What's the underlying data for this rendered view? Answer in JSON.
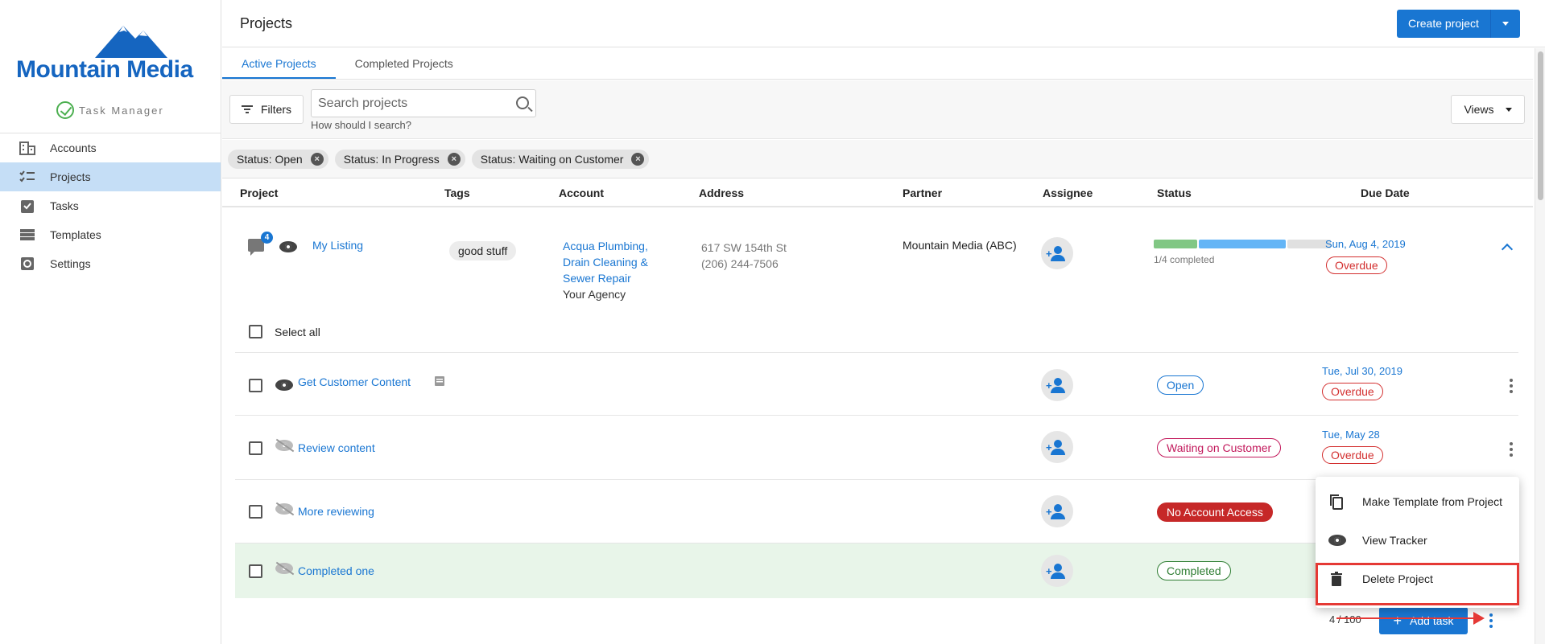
{
  "brand": {
    "logo_text": "Mountain Media",
    "subtitle": "Task Manager",
    "accent": "#1976d2"
  },
  "sidebar": {
    "items": [
      {
        "label": "Accounts",
        "icon": "building-icon",
        "active": false
      },
      {
        "label": "Projects",
        "icon": "checklist-icon",
        "active": true
      },
      {
        "label": "Tasks",
        "icon": "clipboard-check-icon",
        "active": false
      },
      {
        "label": "Templates",
        "icon": "table-icon",
        "active": false
      },
      {
        "label": "Settings",
        "icon": "gear-icon",
        "active": false
      }
    ]
  },
  "header": {
    "title": "Projects",
    "create_label": "Create project"
  },
  "tabs": [
    {
      "label": "Active Projects",
      "active": true
    },
    {
      "label": "Completed Projects",
      "active": false
    }
  ],
  "toolbar": {
    "filters_label": "Filters",
    "search_placeholder": "Search projects",
    "search_value": "",
    "search_help": "How should I search?",
    "views_label": "Views"
  },
  "chips": [
    "Status: Open",
    "Status: In Progress",
    "Status: Waiting on Customer"
  ],
  "columns": [
    "Project",
    "Tags",
    "Account",
    "Address",
    "Partner",
    "Assignee",
    "Status",
    "Due Date"
  ],
  "project": {
    "comment_count": "4",
    "name": "My Listing",
    "tag": "good stuff",
    "account_name": "Acqua Plumbing, Drain Cleaning & Sewer Repair",
    "account_sub": "Your Agency",
    "address_line1": "617 SW 154th St",
    "address_line2": "(206) 244-7506",
    "partner": "Mountain Media (ABC)",
    "progress_label": "1/4 completed",
    "progress": {
      "completed": 1,
      "in_progress": 2,
      "remaining": 1,
      "total": 4
    },
    "due_date": "Sun, Aug 4, 2019",
    "due_status": "Overdue"
  },
  "select_all_label": "Select all",
  "tasks": [
    {
      "name": "Get Customer Content",
      "status": "Open",
      "due_date": "Tue, Jul 30, 2019",
      "due_status": "Overdue",
      "visible": true
    },
    {
      "name": "Review content",
      "status": "Waiting on Customer",
      "due_date": "Tue, May 28",
      "due_status": "Overdue",
      "visible": false
    },
    {
      "name": "More reviewing",
      "status": "No Account Access",
      "due_date": "",
      "due_status": "",
      "visible": false
    },
    {
      "name": "Completed one",
      "status": "Completed",
      "due_date": "",
      "due_status": "",
      "visible": false
    }
  ],
  "footer": {
    "count": "4 / 100",
    "add_task_label": "Add task"
  },
  "menu": {
    "items": [
      {
        "label": "Make Template from Project",
        "icon": "copy-icon"
      },
      {
        "label": "View Tracker",
        "icon": "eye-icon"
      },
      {
        "label": "Delete Project",
        "icon": "trash-icon"
      }
    ]
  },
  "colors": {
    "progress_done": "#81c784",
    "progress_active": "#64b5f6",
    "progress_remaining": "#e0e0e0",
    "completed_row_bg": "#e8f5e9",
    "highlight": "#e53935"
  }
}
